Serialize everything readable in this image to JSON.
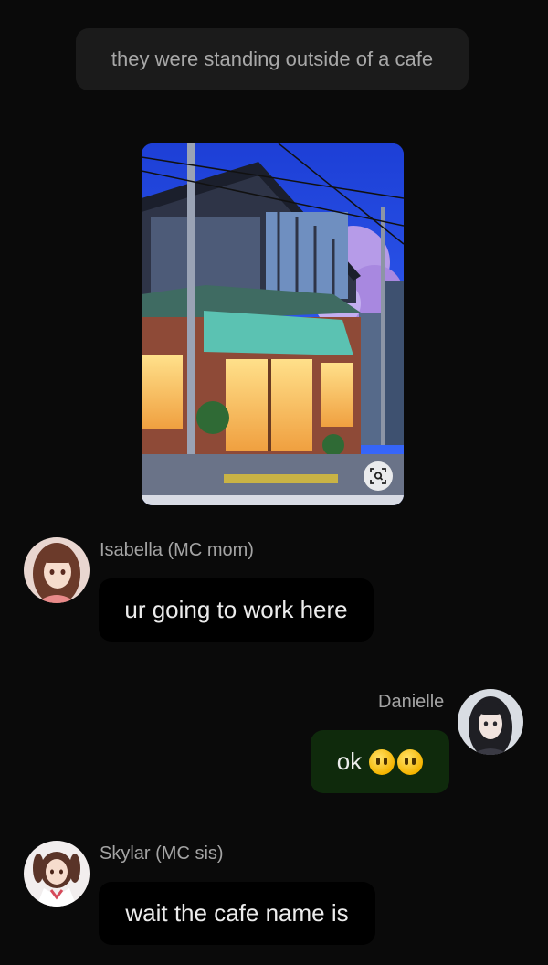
{
  "narration": {
    "text": "they were standing outside of a cafe"
  },
  "image": {
    "subject": "illustrated corner cafe building at dusk",
    "lens_icon": "visual-search-icon"
  },
  "messages": [
    {
      "sender": "Isabella (MC mom)",
      "text": "ur going to work here",
      "side": "left",
      "avatar_icon": "character-avatar-isabella"
    },
    {
      "sender": "Danielle",
      "text": "ok",
      "emojis": [
        "😶",
        "😶"
      ],
      "side": "right",
      "avatar_icon": "character-avatar-danielle"
    },
    {
      "sender": "Skylar (MC sis)",
      "text": "wait the cafe name is",
      "side": "left",
      "avatar_icon": "character-avatar-skylar"
    }
  ],
  "colors": {
    "background": "#0a0a0a",
    "narration_bg": "#1b1b1b",
    "bubble_other": "#000000",
    "bubble_self": "#0f2a0c",
    "name_text": "#a4a4a4"
  }
}
